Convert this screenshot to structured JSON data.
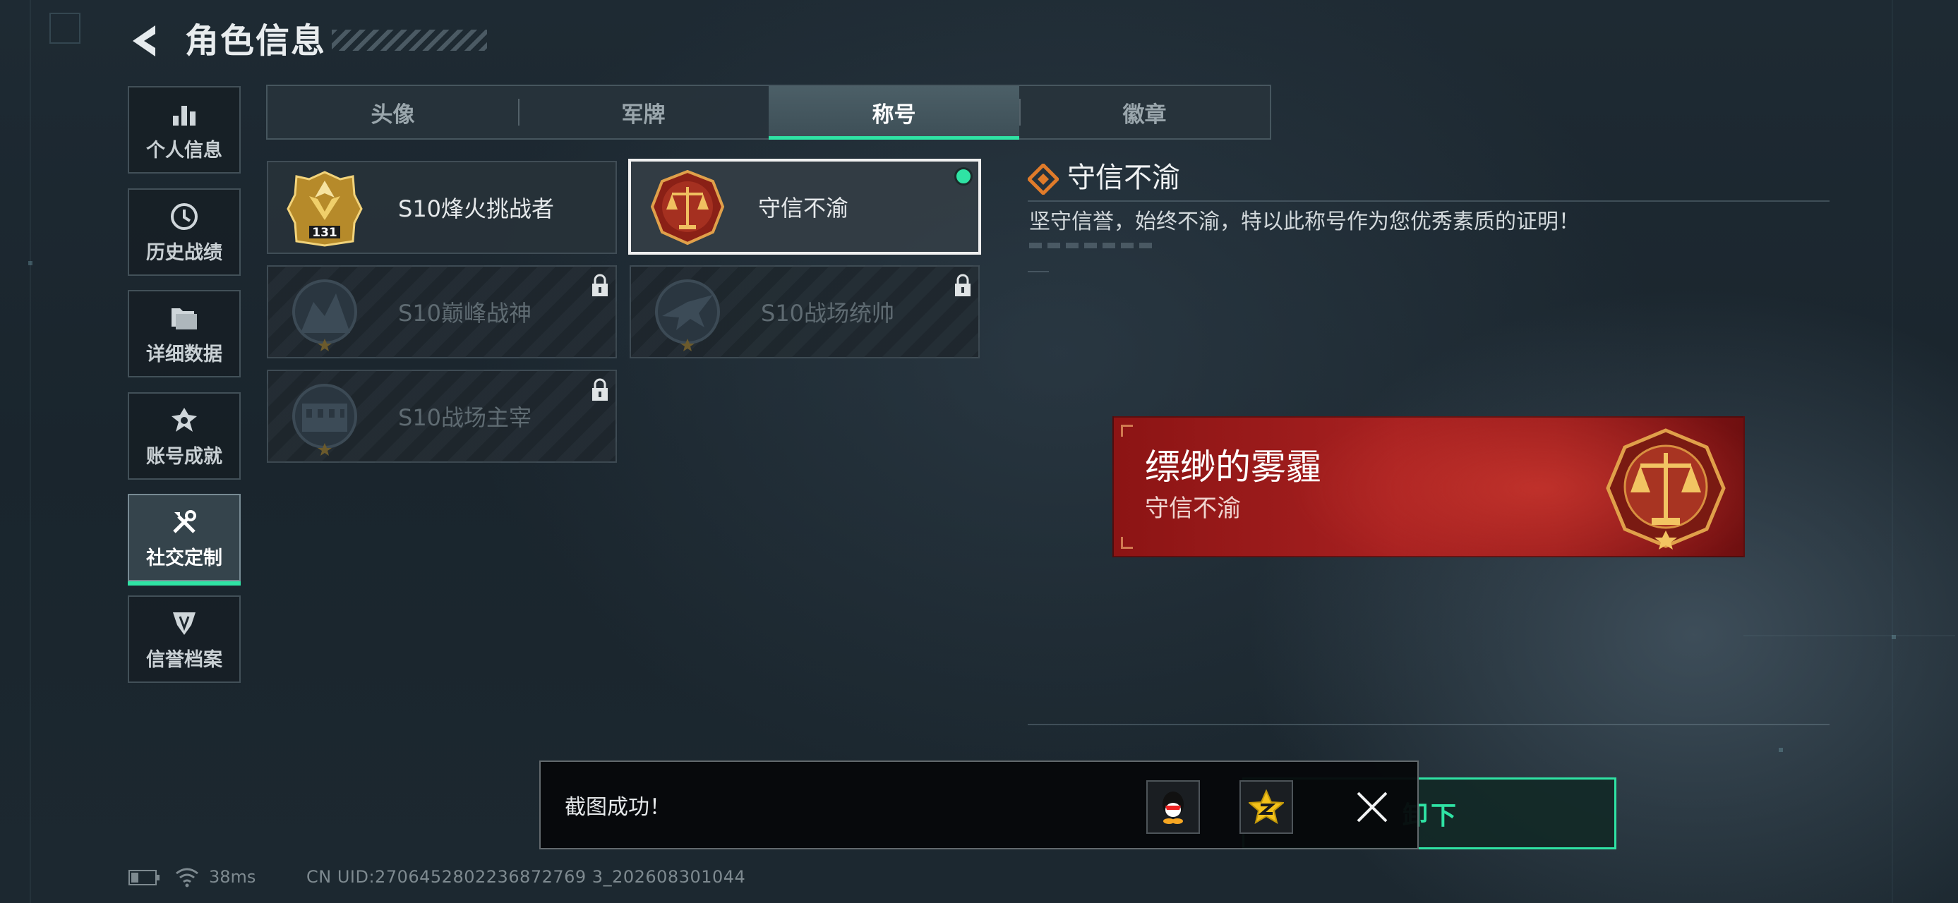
{
  "header": {
    "title": "角色信息"
  },
  "sidebar": {
    "items": [
      {
        "label": "个人信息",
        "icon": "bar-chart-icon",
        "active": false
      },
      {
        "label": "历史战绩",
        "icon": "clock-history-icon",
        "active": false
      },
      {
        "label": "详细数据",
        "icon": "folder-icon",
        "active": false
      },
      {
        "label": "账号成就",
        "icon": "achievement-emblem-icon",
        "active": false
      },
      {
        "label": "社交定制",
        "icon": "tools-icon",
        "active": true
      },
      {
        "label": "信誉档案",
        "icon": "credit-shield-icon",
        "active": false
      }
    ]
  },
  "tabs": [
    {
      "label": "头像",
      "active": false
    },
    {
      "label": "军牌",
      "active": false
    },
    {
      "label": "称号",
      "active": true
    },
    {
      "label": "徽章",
      "active": false
    }
  ],
  "titles": [
    {
      "name": "S10烽火挑战者",
      "badge": "gold-lv-badge-icon",
      "badge_text": "131",
      "locked": false,
      "selected": false,
      "equipped": false
    },
    {
      "name": "守信不渝",
      "badge": "scales-badge-icon",
      "locked": false,
      "selected": true,
      "equipped": true
    },
    {
      "name": "S10巅峰战神",
      "badge": "dark-peak-badge-icon",
      "locked": true,
      "selected": false,
      "equipped": false
    },
    {
      "name": "S10战场统帅",
      "badge": "dark-jet-badge-icon",
      "locked": true,
      "selected": false,
      "equipped": false
    },
    {
      "name": "S10战场主宰",
      "badge": "dark-colosseum-badge-icon",
      "locked": true,
      "selected": false,
      "equipped": false
    }
  ],
  "detail": {
    "title": "守信不渝",
    "description": "坚守信誉，始终不渝，特以此称号作为您优秀素质的证明！",
    "icon": "diamond-icon"
  },
  "banner": {
    "player_name": "缥缈的雾霾",
    "title": "守信不渝",
    "badge": "scales-badge-icon"
  },
  "unequip_button": {
    "label": "卸下"
  },
  "toast": {
    "message": "截图成功！",
    "share_buttons": [
      "qq-share-icon",
      "qzone-share-icon"
    ],
    "close": "close-icon"
  },
  "status": {
    "ping": "38ms",
    "uid": "CN UID:2706452802236872769 3_202608301044"
  },
  "colors": {
    "accent": "#2fe3a4",
    "banner_red": "#a62020",
    "background": "#1e2a33"
  }
}
